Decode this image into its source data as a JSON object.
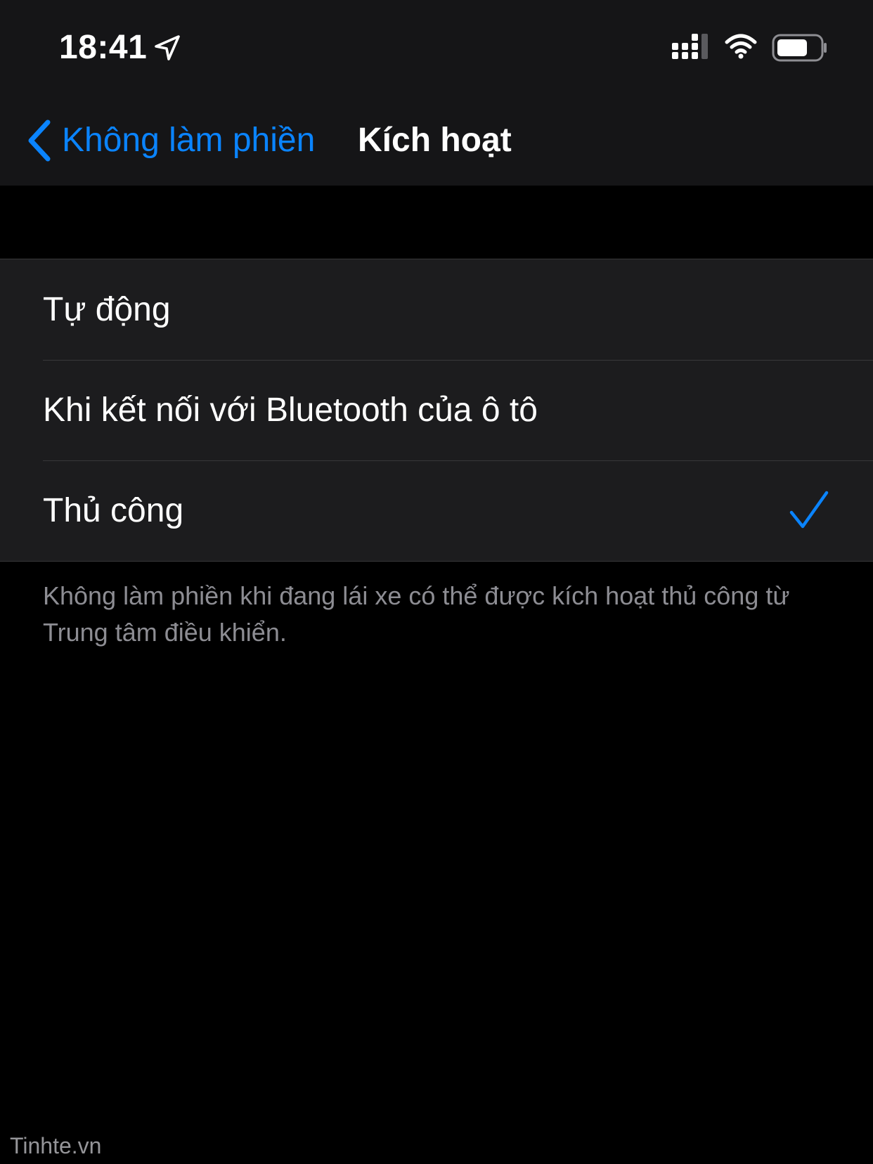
{
  "status_bar": {
    "time": "18:41",
    "icons": [
      "location-arrow-icon",
      "cellular-signal-icon",
      "wifi-icon",
      "battery-icon"
    ]
  },
  "nav": {
    "back_label": "Không làm phiền",
    "title": "Kích hoạt"
  },
  "options": [
    {
      "label": "Tự động",
      "selected": false
    },
    {
      "label": "Khi kết nối với Bluetooth của ô tô",
      "selected": false
    },
    {
      "label": "Thủ công",
      "selected": true
    }
  ],
  "footer_note": "Không làm phiền khi đang lái xe có thể được kích hoạt thủ công từ Trung tâm điều khiển.",
  "watermark": "Tinhte.vn",
  "colors": {
    "accent": "#0a84ff",
    "background": "#000000",
    "cell_background": "#1c1c1e",
    "header_background": "#151517",
    "secondary_text": "#8d8d93",
    "separator": "#38383a"
  }
}
